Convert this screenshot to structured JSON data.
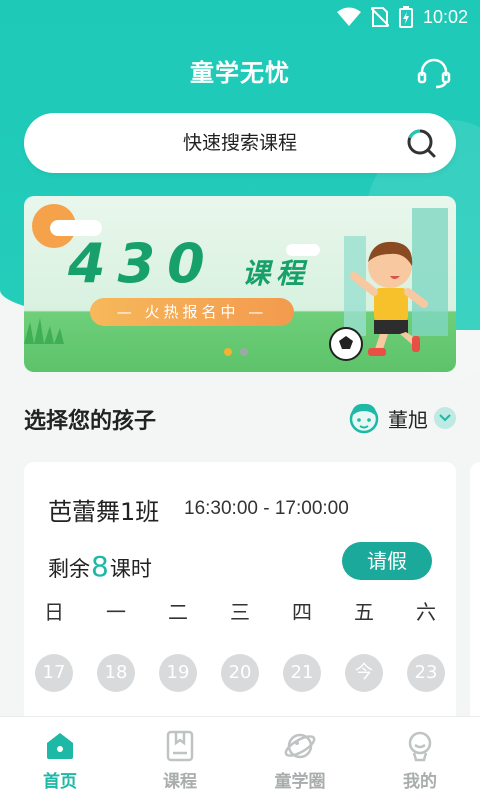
{
  "status_bar": {
    "time": "10:02"
  },
  "header": {
    "title": "童学无忧"
  },
  "search": {
    "placeholder": "快速搜索课程"
  },
  "banner": {
    "title": "430",
    "title_suffix": "课程",
    "tagline": "— 火热报名中 —"
  },
  "child": {
    "section_title": "选择您的孩子",
    "selected_name": "董旭"
  },
  "class_card": {
    "name": "芭蕾舞1班",
    "time": "16:30:00 - 17:00:00",
    "remain_prefix": "剩余",
    "remain_count": "8",
    "remain_suffix": "课时",
    "leave_button": "请假",
    "weekdays": [
      "日",
      "一",
      "二",
      "三",
      "四",
      "五",
      "六"
    ],
    "dates": [
      "17",
      "18",
      "19",
      "20",
      "21",
      "今",
      "23"
    ]
  },
  "tabs": [
    {
      "label": "首页",
      "icon": "home-icon",
      "active": true
    },
    {
      "label": "课程",
      "icon": "book-icon",
      "active": false
    },
    {
      "label": "童学圈",
      "icon": "planet-icon",
      "active": false
    },
    {
      "label": "我的",
      "icon": "profile-icon",
      "active": false
    }
  ],
  "colors": {
    "accent": "#1ec9b7",
    "button": "#1aa99a",
    "inactive": "#a9adad"
  }
}
